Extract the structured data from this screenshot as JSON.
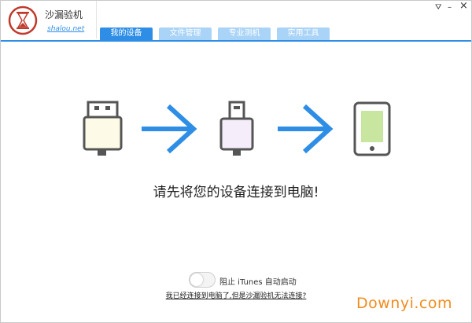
{
  "app": {
    "name": "沙漏验机",
    "url": "shalou.net"
  },
  "tabs": [
    {
      "label": "我的设备",
      "active": true
    },
    {
      "label": "文件管理",
      "active": false
    },
    {
      "label": "专业测机",
      "active": false
    },
    {
      "label": "实用工具",
      "active": false
    }
  ],
  "window_controls": {
    "menu": "⛛",
    "minimize": "–",
    "close": "×"
  },
  "main": {
    "prompt": "请先将您的设备连接到电脑!",
    "toggle": {
      "label": "阻止 iTunes 自动启动",
      "on": false
    },
    "help_link": "我已经连接到电脑了,但是沙漏验机无法连接?"
  },
  "icons": [
    "hourglass-logo-icon",
    "usb-plug-icon",
    "arrow-right-icon",
    "lightning-plug-icon",
    "arrow-right-icon",
    "phone-icon"
  ],
  "colors": {
    "accent": "#2e8ee6",
    "tab_inactive": "#a9d3f7",
    "logo_red": "#c0392b",
    "screen_green": "#c8e6a0"
  },
  "watermark": "Downyi.com"
}
